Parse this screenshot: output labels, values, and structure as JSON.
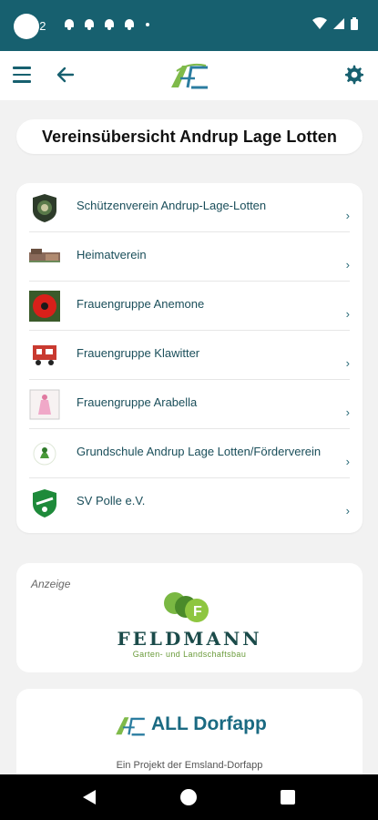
{
  "status_bar": {
    "time": "42"
  },
  "header": {
    "logo_name": "all-logo",
    "menu_icon": "menu-icon",
    "back_icon": "back-arrow-icon",
    "settings_icon": "gear-icon"
  },
  "page": {
    "title": "Vereinsübersicht Andrup Lage Lotten"
  },
  "clubs": [
    {
      "label": "Schützenverein Andrup-Lage-Lotten",
      "chevron": "›"
    },
    {
      "label": "Heimatverein",
      "chevron": "›"
    },
    {
      "label": "Frauengruppe Anemone",
      "chevron": "›"
    },
    {
      "label": "Frauengruppe Klawitter",
      "chevron": "›"
    },
    {
      "label": "Frauengruppe Arabella",
      "chevron": "›"
    },
    {
      "label": "Grundschule Andrup Lage Lotten/Förderverein",
      "chevron": "›"
    },
    {
      "label": "SV Polle e.V.",
      "chevron": "›"
    }
  ],
  "ad": {
    "label": "Anzeige",
    "company": "FELDMANN",
    "tagline": "Garten- und Landschaftsbau"
  },
  "brand": {
    "name": "ALL Dorfapp",
    "subtitle": "Ein Projekt der Emsland-Dorfapp"
  },
  "colors": {
    "primary": "#17606f",
    "label_text": "#1a4e5a",
    "brand_blue": "#1a6a82",
    "green": "#6fb63a"
  }
}
